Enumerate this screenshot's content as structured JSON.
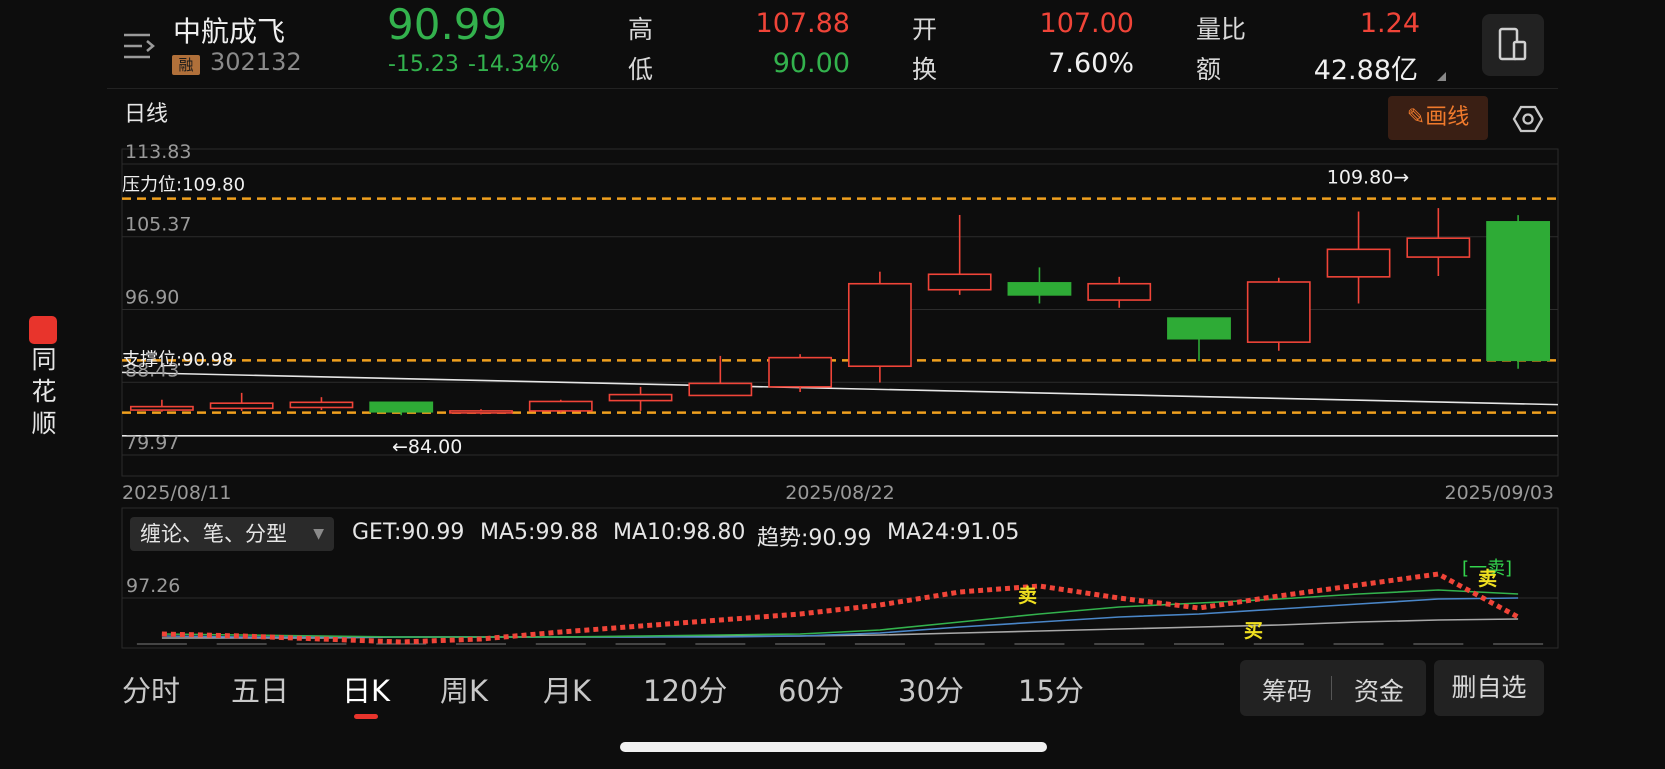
{
  "brand": {
    "chars": [
      "同",
      "花",
      "顺"
    ]
  },
  "header": {
    "stock_name": "中航成飞",
    "badge": "融",
    "code": "302132",
    "price": "90.99",
    "change": "-15.23",
    "change_pct": "-14.34%",
    "stats": [
      {
        "key": "高",
        "value": "107.88",
        "color": "#f04438"
      },
      {
        "key": "开",
        "value": "107.00",
        "color": "#f04438"
      },
      {
        "key": "量比",
        "value": "1.24",
        "color": "#f04438"
      },
      {
        "key": "低",
        "value": "90.00",
        "color": "#33b24d"
      },
      {
        "key": "换",
        "value": "7.60%",
        "color": "#f0f0f0"
      },
      {
        "key": "额",
        "value": "42.88亿",
        "color": "#f0f0f0"
      }
    ]
  },
  "chart_header": {
    "label": "日线",
    "draw_button": "画线"
  },
  "chart_data": {
    "type": "candlestick",
    "ylim": [
      79.97,
      113.83
    ],
    "y_ticks": [
      "113.83",
      "105.37",
      "96.90",
      "88.43",
      "79.97"
    ],
    "x_labels": [
      "2025/08/11",
      "2025/08/22",
      "2025/09/03"
    ],
    "annotations": {
      "resistance": "压力位:109.80",
      "resistance_value": 109.8,
      "resistance_arrow": "109.80→",
      "support": "支撑位:90.98",
      "support_value": 90.98,
      "lower_dash_value": 84.9,
      "low_marker": "←84.00",
      "low_value": 82.2
    },
    "candles": [
      {
        "o": 85.2,
        "c": 85.6,
        "h": 86.4,
        "l": 85.0
      },
      {
        "o": 85.4,
        "c": 86.0,
        "h": 87.2,
        "l": 85.1
      },
      {
        "o": 85.5,
        "c": 86.1,
        "h": 86.7,
        "l": 85.2
      },
      {
        "o": 86.1,
        "c": 85.0,
        "h": 86.1,
        "l": 84.6
      },
      {
        "o": 84.9,
        "c": 85.1,
        "h": 85.3,
        "l": 84.7
      },
      {
        "o": 85.1,
        "c": 86.2,
        "h": 86.4,
        "l": 84.9
      },
      {
        "o": 86.3,
        "c": 87.0,
        "h": 87.9,
        "l": 85.1
      },
      {
        "o": 86.9,
        "c": 88.3,
        "h": 91.5,
        "l": 86.9
      },
      {
        "o": 87.9,
        "c": 91.3,
        "h": 91.7,
        "l": 87.3
      },
      {
        "o": 90.3,
        "c": 99.9,
        "h": 101.3,
        "l": 88.4
      },
      {
        "o": 99.2,
        "c": 101.0,
        "h": 107.9,
        "l": 98.6
      },
      {
        "o": 100.0,
        "c": 98.6,
        "h": 101.8,
        "l": 97.6
      },
      {
        "o": 98.0,
        "c": 99.9,
        "h": 100.7,
        "l": 97.1
      },
      {
        "o": 95.9,
        "c": 93.5,
        "h": 95.9,
        "l": 90.9
      },
      {
        "o": 93.1,
        "c": 100.1,
        "h": 100.6,
        "l": 92.1
      },
      {
        "o": 100.7,
        "c": 103.9,
        "h": 108.3,
        "l": 97.6
      },
      {
        "o": 103.0,
        "c": 105.2,
        "h": 108.7,
        "l": 100.8
      },
      {
        "o": 107.1,
        "c": 90.99,
        "h": 107.88,
        "l": 90.0
      }
    ],
    "indicator": {
      "select": "缠论、笔、分型",
      "legend": [
        {
          "label": "GET:90.99",
          "color": "#f04438"
        },
        {
          "label": "MA5:99.88",
          "color": "#33b24d"
        },
        {
          "label": "MA10:98.80",
          "color": "#4a86c8"
        },
        {
          "label": "趋势:90.99",
          "color": "#e6e6e6"
        },
        {
          "label": "MA24:91.05",
          "color": "#a8a8a8"
        }
      ],
      "y_tick": "97.26",
      "signals": [
        {
          "label": "卖",
          "color": "#f0e020"
        },
        {
          "label": "买",
          "color": "#f0e020"
        },
        {
          "label": "[一卖]",
          "color": "#33d44d"
        },
        {
          "label": "卖",
          "color": "#f0e020"
        }
      ]
    }
  },
  "tabs": [
    {
      "label": "分时",
      "active": false
    },
    {
      "label": "五日",
      "active": false
    },
    {
      "label": "日K",
      "active": true
    },
    {
      "label": "周K",
      "active": false
    },
    {
      "label": "月K",
      "active": false
    },
    {
      "label": "120分",
      "active": false
    },
    {
      "label": "60分",
      "active": false
    },
    {
      "label": "30分",
      "active": false
    },
    {
      "label": "15分",
      "active": false
    }
  ],
  "bottom_buttons": {
    "chouma": "筹码",
    "zijin": "资金",
    "delete": "删自选"
  },
  "colors": {
    "up": "#f04438",
    "down": "#2eab36",
    "dash": "#f0a01e"
  }
}
